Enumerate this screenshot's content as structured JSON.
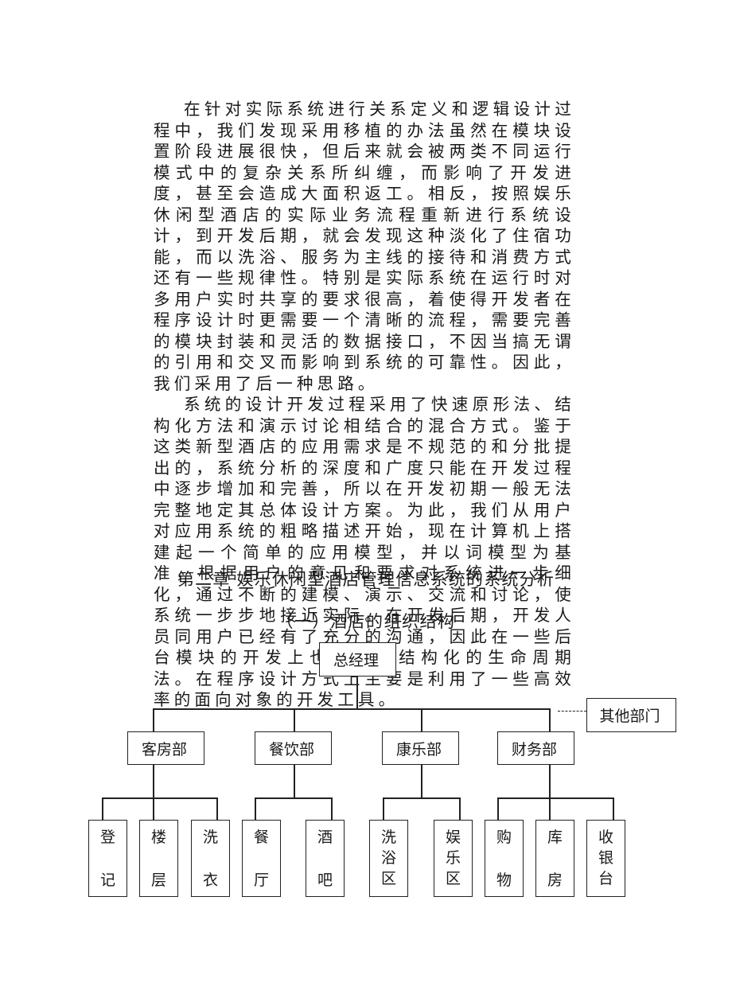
{
  "paragraphs": [
    "在针对实际系统进行关系定义和逻辑设计过程中，我们发现采用移植的办法虽然在模块设置阶段进展很快，但后来就会被两类不同运行模式中的复杂关系所纠缠，而影响了开发进度，甚至会造成大面积返工。相反，按照娱乐休闲型酒店的实际业务流程重新进行系统设计，到开发后期，就会发现这种淡化了住宿功能，而以洗浴、服务为主线的接待和消费方式还有一些规律性。特别是实际系统在运行时对多用户实时共享的要求很高，着使得开发者在程序设计时更需要一个清晰的流程，需要完善的模块封装和灵活的数据接口，不因当搞无谓的引用和交叉而影响到系统的可靠性。因此，我们采用了后一种思路。",
    "系统的设计开发过程采用了快速原形法、结构化方法和演示讨论相结合的混合方式。鉴于这类新型酒店的应用需求是不规范的和分批提出的，系统分析的深度和广度只能在开发过程中逐步增加和完善，所以在开发初期一般无法完整地定其总体设计方案。为此，我们从用户对应用系统的粗略描述开始，现在计算机上搭建起一个简单的应用模型，并以词模型为基准，根据用户的意见和要求对系统进一步细化，通过不断的建模、演示、交流和讨论，使系统一步步地接近实际。在开发后期，开发人员同用户已经有了充分的沟通，因此在一些后台模块的开发上也遵循了结构化的生命周期法。在程序设计方式上主要是利用了一些高效率的面向对象的开发工具。"
  ],
  "chapter_title": "第二章  娱乐休闲型酒店管理信息系统的系统分析",
  "section_title": "（一）酒店的组织结构",
  "org_chart": {
    "root": "总经理",
    "other": "其他部门",
    "departments": [
      {
        "name": "客房部",
        "units": [
          "登记",
          "楼层",
          "洗衣"
        ]
      },
      {
        "name": "餐饮部",
        "units": [
          "餐厅",
          "酒吧"
        ]
      },
      {
        "name": "康乐部",
        "units": [
          "洗浴区",
          "娱乐区"
        ]
      },
      {
        "name": "财务部",
        "units": [
          "购物",
          "库房",
          "收银台"
        ]
      }
    ]
  }
}
